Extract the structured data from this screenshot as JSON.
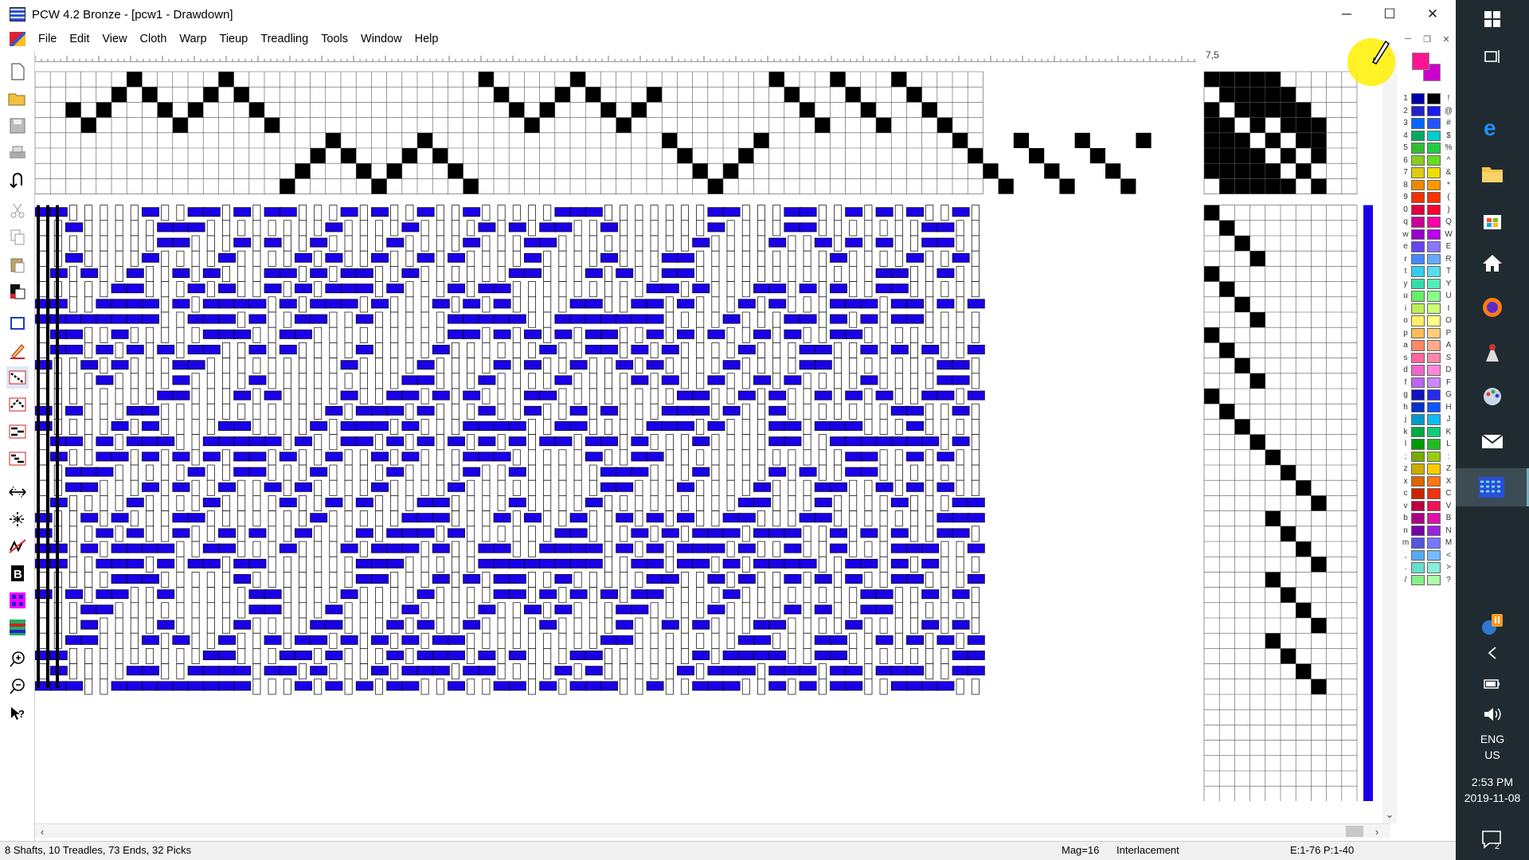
{
  "window": {
    "title": "PCW 4.2 Bronze - [pcw1 - Drawdown]",
    "minimize": "─",
    "maximize": "☐",
    "close": "✕"
  },
  "menu": {
    "items": [
      "File",
      "Edit",
      "View",
      "Cloth",
      "Warp",
      "Tieup",
      "Treadling",
      "Tools",
      "Window",
      "Help"
    ]
  },
  "ruler": {
    "label": "7,5"
  },
  "palette": {
    "foreground": "#ff1493",
    "background": "#cc00cc",
    "left_keys": [
      "1",
      "2",
      "3",
      "4",
      "5",
      "6",
      "7",
      "8",
      "9",
      "0",
      "q",
      "w",
      "e",
      "r",
      "t",
      "y",
      "u",
      "i",
      "o",
      "p",
      "a",
      "s",
      "d",
      "f",
      "g",
      "h",
      "j",
      "k",
      "l",
      ";",
      "z",
      "x",
      "c",
      "v",
      "b",
      "n",
      "m",
      ",",
      ".",
      "/"
    ],
    "right_keys": [
      "!",
      "@",
      "#",
      "$",
      "%",
      "^",
      "&",
      "*",
      "(",
      ")",
      "Q",
      "W",
      "E",
      "R",
      "T",
      "Y",
      "U",
      "I",
      "O",
      "P",
      "A",
      "S",
      "D",
      "F",
      "G",
      "H",
      "J",
      "K",
      "L",
      ":",
      "Z",
      "X",
      "C",
      "V",
      "B",
      "N",
      "M",
      "<",
      ">",
      "?"
    ],
    "col1": [
      "#0000aa",
      "#2222cc",
      "#0066ff",
      "#00aa66",
      "#33bb33",
      "#88cc22",
      "#ddcc11",
      "#ee8800",
      "#ee3300",
      "#dd0044",
      "#cc0099",
      "#9900cc",
      "#6644ee",
      "#4488ff",
      "#33ccee",
      "#33ddaa",
      "#66ee66",
      "#bbee55",
      "#ffee66",
      "#ffbb55",
      "#ff8866",
      "#ff6699",
      "#ee66cc",
      "#bb66ee",
      "#1111bb",
      "#0033cc",
      "#0099cc",
      "#00aa44",
      "#009900",
      "#77aa00",
      "#ccaa00",
      "#dd6600",
      "#cc2200",
      "#bb0044",
      "#aa0088",
      "#7700aa",
      "#5555dd",
      "#55aaee",
      "#66ddcc",
      "#88ee88"
    ],
    "col2": [
      "#000000",
      "#1a1aee",
      "#2255ff",
      "#00cccc",
      "#22cc44",
      "#66dd22",
      "#eedd00",
      "#ff9900",
      "#ff3300",
      "#ff0033",
      "#ff00aa",
      "#bb00ee",
      "#8877ff",
      "#66aaff",
      "#55ddee",
      "#55eebb",
      "#88ff88",
      "#ccff77",
      "#ffff88",
      "#ffcc77",
      "#ffaa88",
      "#ff88aa",
      "#ff88dd",
      "#cc88ff",
      "#2a2aee",
      "#1155ff",
      "#11bbee",
      "#11cc77",
      "#22bb22",
      "#99cc11",
      "#ffcc00",
      "#ff7711",
      "#ee3311",
      "#ee1155",
      "#dd11aa",
      "#9922dd",
      "#7777ff",
      "#77bbff",
      "#88eedd",
      "#aaffaa"
    ]
  },
  "status": {
    "info": "8 Shafts, 10 Treadles, 73 Ends, 32 Picks",
    "mag": "Mag=16",
    "mode": "Interlacement",
    "range": "E:1-76  P:1-40"
  },
  "taskbar": {
    "lang1": "ENG",
    "lang2": "US",
    "time": "2:53 PM",
    "date": "2019-11-08",
    "notification_count": "2"
  },
  "colors": {
    "weft_blue": "#1a00e6",
    "grid_line": "#444444",
    "taskbar_bg": "#1f2b30"
  }
}
